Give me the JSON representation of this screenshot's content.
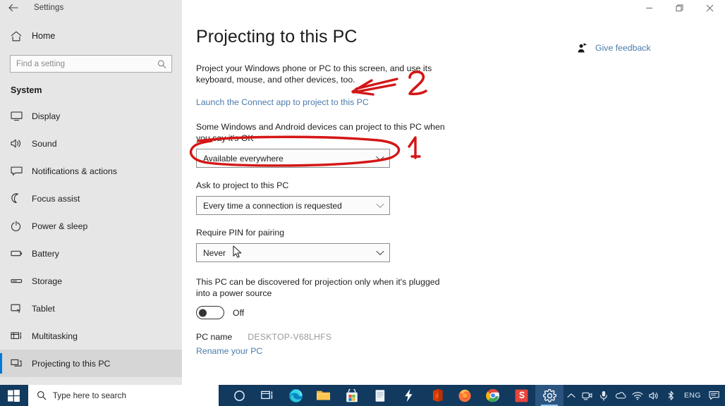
{
  "window": {
    "title": "Settings",
    "back_icon": "back-arrow-icon",
    "minimize_label": "—",
    "maximize_label": "❐",
    "close_label": "✕"
  },
  "sidebar": {
    "home_label": "Home",
    "home_icon": "home-icon",
    "search": {
      "placeholder": "Find a setting",
      "value": "",
      "icon": "search-icon"
    },
    "section_title": "System",
    "items": [
      {
        "label": "Display",
        "icon": "monitor-icon",
        "selected": false
      },
      {
        "label": "Sound",
        "icon": "speaker-icon",
        "selected": false
      },
      {
        "label": "Notifications & actions",
        "icon": "notification-icon",
        "selected": false
      },
      {
        "label": "Focus assist",
        "icon": "moon-icon",
        "selected": false
      },
      {
        "label": "Power & sleep",
        "icon": "power-icon",
        "selected": false
      },
      {
        "label": "Battery",
        "icon": "battery-icon",
        "selected": false
      },
      {
        "label": "Storage",
        "icon": "storage-icon",
        "selected": false
      },
      {
        "label": "Tablet",
        "icon": "tablet-icon",
        "selected": false
      },
      {
        "label": "Multitasking",
        "icon": "multitasking-icon",
        "selected": false
      },
      {
        "label": "Projecting to this PC",
        "icon": "projecting-icon",
        "selected": true
      }
    ]
  },
  "main": {
    "page_title": "Projecting to this PC",
    "intro_paragraph": "Project your Windows phone or PC to this screen, and use its keyboard, mouse, and other devices, too.",
    "connect_link": "Launch the Connect app to project to this PC",
    "availability": {
      "label": "Some Windows and Android devices can project to this PC when you say it's OK",
      "value": "Available everywhere"
    },
    "ask_to_project": {
      "label": "Ask to project to this PC",
      "value": "Every time a connection is requested"
    },
    "require_pin": {
      "label": "Require PIN for pairing",
      "value": "Never"
    },
    "power_source": {
      "label": "This PC can be discovered for projection only when it's plugged into a power source",
      "toggle_state": "Off"
    },
    "pc_name": {
      "key": "PC name",
      "value": "DESKTOP-V68LHFS",
      "rename_link": "Rename your PC"
    }
  },
  "feedback": {
    "label": "Give feedback",
    "icon": "feedback-person-icon"
  },
  "annotations": {
    "color": "#d41616",
    "marks": [
      {
        "name": "arrow-to-connect-link",
        "kind": "arrow",
        "number": "2"
      },
      {
        "name": "ellipse-around-availability-dropdown",
        "kind": "ellipse",
        "number": "1"
      }
    ],
    "number_two": "2",
    "number_one": "1"
  },
  "taskbar": {
    "start_icon": "windows-start-icon",
    "search": {
      "placeholder": "Type here to search",
      "icon": "search-icon"
    },
    "items": [
      {
        "name": "cortana-icon",
        "label": "Cortana",
        "active": false
      },
      {
        "name": "task-view-icon",
        "label": "Task View",
        "active": false
      },
      {
        "name": "edge-icon",
        "label": "Microsoft Edge",
        "active": false
      },
      {
        "name": "file-explorer-icon",
        "label": "File Explorer",
        "active": false
      },
      {
        "name": "microsoft-store-icon",
        "label": "Microsoft Store",
        "active": false
      },
      {
        "name": "notepad-icon",
        "label": "Notes",
        "active": false
      },
      {
        "name": "lightning-icon",
        "label": "PowerShell",
        "active": false
      },
      {
        "name": "office-icon",
        "label": "Office",
        "active": false
      },
      {
        "name": "firefox-icon",
        "label": "Firefox",
        "active": false
      },
      {
        "name": "chrome-icon",
        "label": "Google Chrome",
        "active": false
      },
      {
        "name": "snipaste-icon",
        "label": "Snipaste",
        "active": false
      },
      {
        "name": "settings-gear-icon",
        "label": "Settings",
        "active": true
      }
    ],
    "tray": {
      "chevron": "show-hidden-icons",
      "icons": [
        "meeting-camera-icon",
        "microphone-icon",
        "onedrive-icon",
        "wifi-icon",
        "volume-icon",
        "bluetooth-icon"
      ],
      "language": "ENG",
      "action_center": "action-center-icon"
    }
  }
}
